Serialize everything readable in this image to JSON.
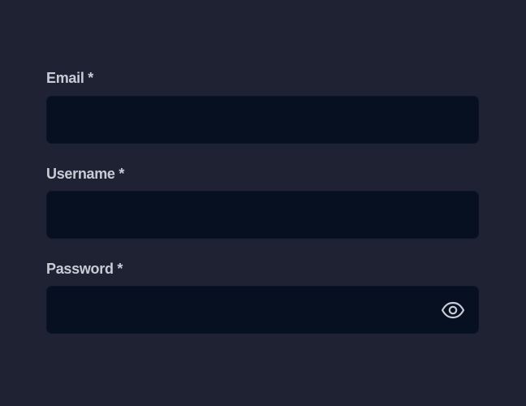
{
  "form": {
    "email": {
      "label": "Email *",
      "value": "",
      "placeholder": ""
    },
    "username": {
      "label": "Username *",
      "value": "",
      "placeholder": ""
    },
    "password": {
      "label": "Password *",
      "value": "",
      "placeholder": "",
      "toggle_icon": "eye-icon"
    }
  },
  "colors": {
    "background": "#1f2233",
    "input_background": "#071021",
    "label_text": "#c9ccd6",
    "icon": "#c9ccd6"
  }
}
